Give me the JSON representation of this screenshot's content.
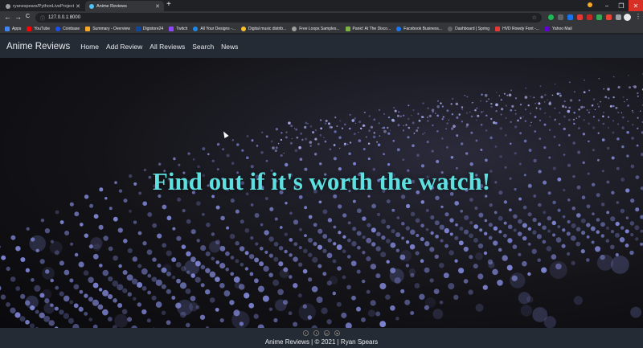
{
  "browser": {
    "tabs": [
      {
        "title": "ryanespears/PythonLiveProject",
        "active": false
      },
      {
        "title": "Anime Reviews",
        "active": true
      }
    ],
    "new_tab_symbol": "+",
    "url": "127.0.0.1:8000",
    "nav": {
      "back": "←",
      "forward": "→",
      "reload": "C"
    },
    "window_controls": {
      "minimize": "−",
      "restore": "❐",
      "close": "✕"
    },
    "bookmarks": [
      {
        "label": "Apps",
        "color": "#4285f4"
      },
      {
        "label": "YouTube",
        "color": "#ff0000"
      },
      {
        "label": "Coinbase",
        "color": "#1652f0"
      },
      {
        "label": "Summary - Overview",
        "color": "#f9a825"
      },
      {
        "label": "Digistore24",
        "color": "#0d47a1"
      },
      {
        "label": "Twitch",
        "color": "#9146ff"
      },
      {
        "label": "All Your Designs -...",
        "color": "#1e88e5"
      },
      {
        "label": "Digital music distrib...",
        "color": "#fbc02d"
      },
      {
        "label": "Free Loops Samples...",
        "color": "#9e9e9e"
      },
      {
        "label": "Panic! At The Disco...",
        "color": "#7cb342"
      },
      {
        "label": "Facebook Business...",
        "color": "#1877f2"
      },
      {
        "label": "Dashboard | Spring",
        "color": "#616161"
      },
      {
        "label": "HVD Rowdy Font -...",
        "color": "#e53935"
      },
      {
        "label": "Yahoo Mail",
        "color": "#6001d2"
      }
    ]
  },
  "site": {
    "brand": "Anime Reviews",
    "nav": [
      "Home",
      "Add Review",
      "All Reviews",
      "Search",
      "News"
    ],
    "headline": "Find out if it's worth the watch!",
    "footer": "Anime Reviews | © 2021 | Ryan Spears",
    "social_icons": [
      "facebook-icon",
      "twitter-icon",
      "pinterest-icon",
      "telegram-icon"
    ]
  },
  "colors": {
    "accent": "#5fe0e0",
    "navbar": "#252b35",
    "particle": "#8f96f0"
  }
}
